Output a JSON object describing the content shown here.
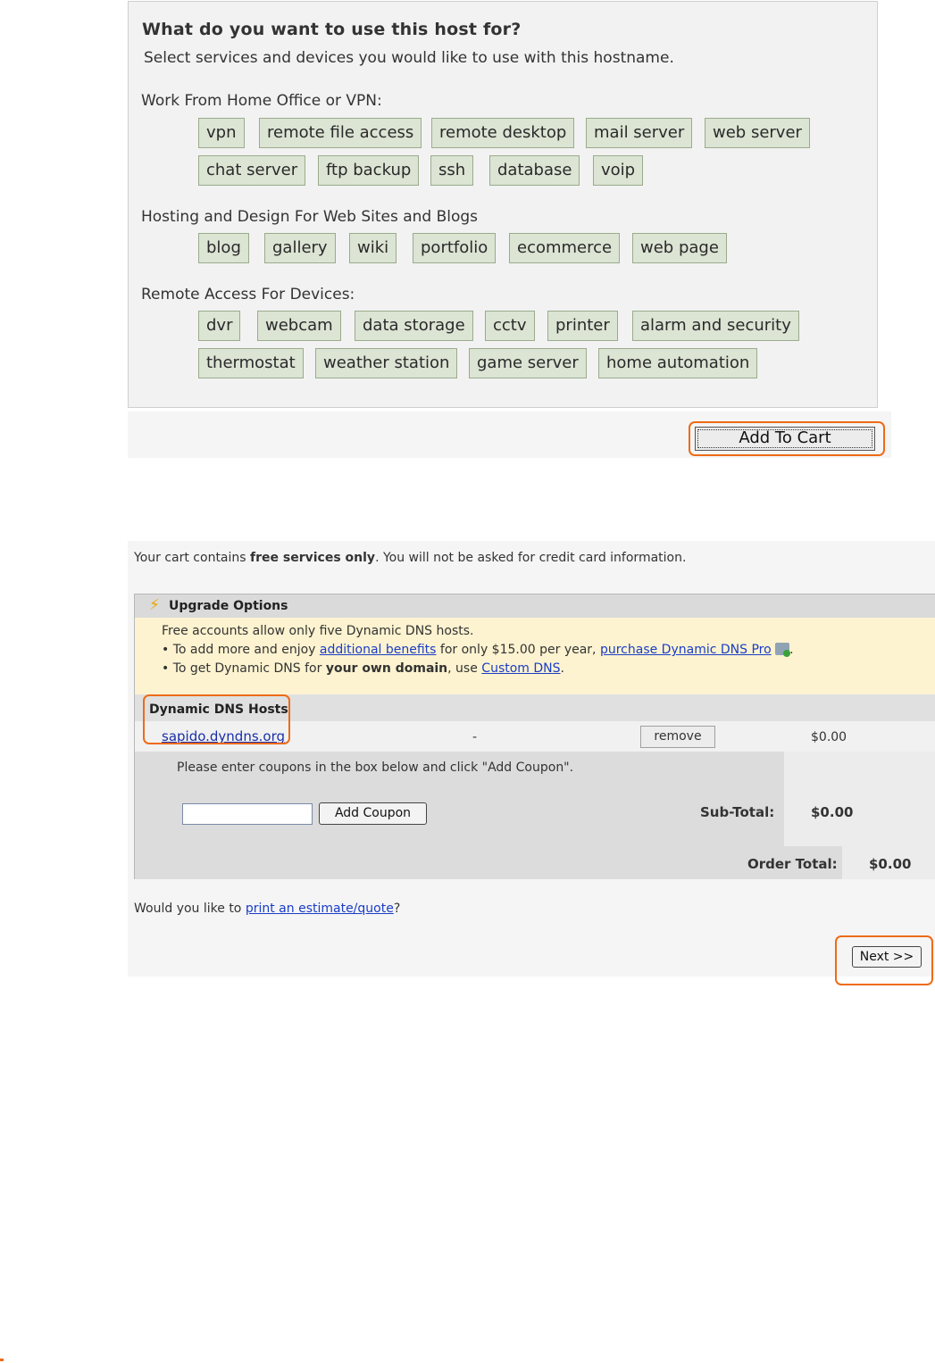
{
  "host_usage": {
    "title": "What do you want to use this host for?",
    "subtitle": "Select services and devices you would like to use with this hostname.",
    "groups": [
      {
        "label": "Work From Home Office or VPN:",
        "items": [
          "vpn",
          "remote file access",
          "remote desktop",
          "mail server",
          "web server",
          "chat server",
          "ftp backup",
          "ssh",
          "database",
          "voip"
        ]
      },
      {
        "label": "Hosting and Design For Web Sites and Blogs",
        "items": [
          "blog",
          "gallery",
          "wiki",
          "portfolio",
          "ecommerce",
          "web page"
        ]
      },
      {
        "label": "Remote Access For Devices:",
        "items": [
          "dvr",
          "webcam",
          "data storage",
          "cctv",
          "printer",
          "alarm and security",
          "thermostat",
          "weather station",
          "game server",
          "home automation"
        ]
      }
    ],
    "add_to_cart_label": "Add To Cart"
  },
  "cart": {
    "note_prefix": "Your cart contains ",
    "note_bold": "free services only",
    "note_suffix": ". You will not be asked for credit card information.",
    "upgrade": {
      "title": "Upgrade Options",
      "icon": "lightning-bolt-icon",
      "line1": "Free accounts allow only five Dynamic DNS hosts.",
      "line2_prefix": "• To add more and enjoy ",
      "line2_link": "additional benefits",
      "line2_mid": " for only $15.00 per year, ",
      "line2_link2": "purchase Dynamic DNS Pro",
      "line2_suffix": ".",
      "line3_prefix": "• To get Dynamic DNS for ",
      "line3_bold": "your own domain",
      "line3_mid": ", use ",
      "line3_link": "Custom DNS",
      "line3_suffix": "."
    },
    "hosts_header": "Dynamic DNS Hosts",
    "host": {
      "name": "sapido.dyndns.org",
      "detail": "-",
      "remove_label": "remove",
      "price": "$0.00"
    },
    "coupon": {
      "instruction": "Please enter coupons in the box below and click \"Add Coupon\".",
      "input_value": "",
      "button_label": "Add Coupon"
    },
    "subtotal_label": "Sub-Total:",
    "subtotal_value": "$0.00",
    "order_total_label": "Order Total:",
    "order_total_value": "$0.00",
    "estimate_prefix": "Would you like to ",
    "estimate_link": "print an estimate/quote",
    "estimate_suffix": "?",
    "next_label": "Next >>"
  },
  "colors": {
    "highlight": "#ee6b16",
    "tag_bg": "#dce4d4",
    "upgrade_bg": "#fdf3d0",
    "link": "#1a3dc7"
  }
}
